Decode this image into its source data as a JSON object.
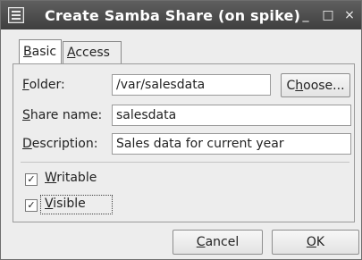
{
  "window": {
    "title": "Create Samba Share (on spike)",
    "title_icon": "samba-app-icon",
    "controls": {
      "minimize": "_",
      "maximize": "□",
      "close": "×"
    }
  },
  "tabs": [
    {
      "label": "Basic",
      "mnemonic": "B",
      "selected": true
    },
    {
      "label": "Access",
      "mnemonic": "A",
      "selected": false
    }
  ],
  "form": {
    "folder_label": "Folder:",
    "folder_value": "/var/salesdata",
    "choose_button": "Choose...",
    "share_name_label": "Share name:",
    "share_name_value": "salesdata",
    "description_label": "Description:",
    "description_value": "Sales data for current year"
  },
  "options": {
    "writable": {
      "label": "Writable",
      "checked": true
    },
    "visible": {
      "label": "Visible",
      "checked": true
    }
  },
  "buttons": {
    "cancel": "Cancel",
    "ok": "OK"
  },
  "colors": {
    "titlebar": "#4f4f4f",
    "dialog_bg": "#ededed"
  }
}
